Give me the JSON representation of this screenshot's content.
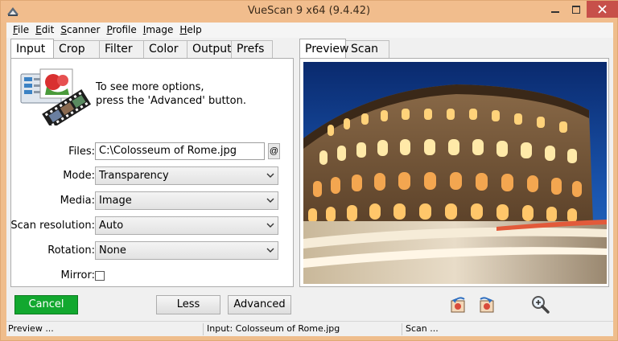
{
  "window": {
    "title": "VueScan 9 x64 (9.4.42)"
  },
  "menu": {
    "items": [
      {
        "label": "File",
        "accel": "F",
        "rest": "ile"
      },
      {
        "label": "Edit",
        "accel": "E",
        "rest": "dit"
      },
      {
        "label": "Scanner",
        "accel": "S",
        "rest": "canner"
      },
      {
        "label": "Profile",
        "accel": "P",
        "rest": "rofile"
      },
      {
        "label": "Image",
        "accel": "I",
        "rest": "mage"
      },
      {
        "label": "Help",
        "accel": "H",
        "rest": "elp"
      }
    ]
  },
  "left_tabs": [
    "Input",
    "Crop",
    "Filter",
    "Color",
    "Output",
    "Prefs"
  ],
  "left_active_tab": "Input",
  "right_tabs": [
    "Preview",
    "Scan"
  ],
  "right_active_tab": "Preview",
  "help": {
    "line1": "To see more options,",
    "line2": "press the 'Advanced' button."
  },
  "form": {
    "files_label": "Files:",
    "files_value": "C:\\Colosseum of Rome.jpg",
    "files_button": "@",
    "mode_label": "Mode:",
    "mode_value": "Transparency",
    "media_label": "Media:",
    "media_value": "Image",
    "resolution_label": "Scan resolution:",
    "resolution_value": "Auto",
    "rotation_label": "Rotation:",
    "rotation_value": "None",
    "mirror_label": "Mirror:",
    "mirror_checked": false
  },
  "buttons": {
    "cancel": "Cancel",
    "less": "Less",
    "advanced": "Advanced"
  },
  "status": {
    "left": "Preview ...",
    "middle": "Input: Colosseum of Rome.jpg",
    "right": "Scan ..."
  },
  "colors": {
    "titlebar": "#f1bd8d",
    "close_button": "#c7504a",
    "cancel_button": "#12a82f"
  },
  "icons": {
    "app": "vuescan-app-icon",
    "rotate_left": "rotate-left-icon",
    "rotate_right": "rotate-right-icon",
    "zoom": "zoom-in-icon"
  }
}
